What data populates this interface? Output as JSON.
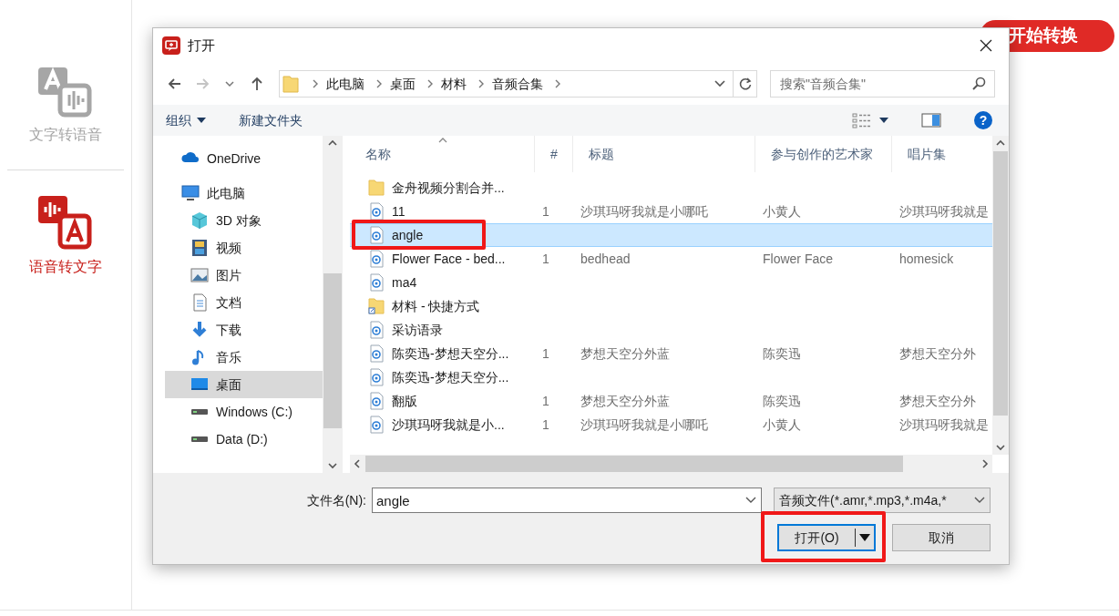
{
  "sidebar": {
    "items": [
      {
        "label": "文字转语音",
        "kind": "text-to-speech",
        "selected": false
      },
      {
        "label": "语音转文字",
        "kind": "speech-to-text",
        "selected": true
      }
    ]
  },
  "start_button": {
    "label": "开始转换"
  },
  "dialog": {
    "title": "打开",
    "breadcrumb": [
      "此电脑",
      "桌面",
      "材料",
      "音频合集"
    ],
    "search": {
      "placeholder": "搜索\"音频合集\""
    },
    "toolbar": {
      "organize": "组织",
      "new_folder": "新建文件夹",
      "help": "?"
    },
    "nav": [
      {
        "label": "OneDrive",
        "kind": "cloud",
        "selected": false
      },
      {
        "label": "此电脑",
        "kind": "pc",
        "selected": false,
        "children": [
          {
            "label": "3D 对象",
            "kind": "cube",
            "selected": false
          },
          {
            "label": "视频",
            "kind": "video",
            "selected": false
          },
          {
            "label": "图片",
            "kind": "picture",
            "selected": false
          },
          {
            "label": "文档",
            "kind": "document",
            "selected": false
          },
          {
            "label": "下载",
            "kind": "download",
            "selected": false
          },
          {
            "label": "音乐",
            "kind": "music",
            "selected": false
          },
          {
            "label": "桌面",
            "kind": "desktop",
            "selected": true
          },
          {
            "label": "Windows (C:)",
            "kind": "drive",
            "selected": false
          },
          {
            "label": "Data (D:)",
            "kind": "drive",
            "selected": false
          }
        ]
      }
    ],
    "columns": [
      {
        "label": "名称",
        "sorted": true
      },
      {
        "label": "#"
      },
      {
        "label": "标题"
      },
      {
        "label": "参与创作的艺术家"
      },
      {
        "label": "唱片集"
      }
    ],
    "files": [
      {
        "kind": "folder",
        "name": "金舟视频分割合并...",
        "selected": false,
        "highlighted": false
      },
      {
        "kind": "audio",
        "name": "11",
        "track": "1",
        "title": "沙琪玛呀我就是小哪吒",
        "artist": "小黄人",
        "album": "沙琪玛呀我就是",
        "selected": false,
        "highlighted": false
      },
      {
        "kind": "audio",
        "name": "angle",
        "selected": true,
        "highlighted": true
      },
      {
        "kind": "audio",
        "name": "Flower Face - bed...",
        "track": "1",
        "title": "bedhead",
        "artist": "Flower Face",
        "album": "homesick",
        "selected": false,
        "highlighted": false
      },
      {
        "kind": "audio",
        "name": "ma4",
        "selected": false,
        "highlighted": false
      },
      {
        "kind": "shortcut",
        "name": "材料 - 快捷方式",
        "selected": false,
        "highlighted": false
      },
      {
        "kind": "audio",
        "name": "采访语录",
        "selected": false,
        "highlighted": false
      },
      {
        "kind": "audio",
        "name": "陈奕迅-梦想天空分...",
        "track": "1",
        "title": "梦想天空分外蓝",
        "artist": "陈奕迅",
        "album": "梦想天空分外",
        "selected": false,
        "highlighted": false
      },
      {
        "kind": "audio",
        "name": "陈奕迅-梦想天空分...",
        "selected": false,
        "highlighted": false
      },
      {
        "kind": "audio",
        "name": "翻版",
        "track": "1",
        "title": "梦想天空分外蓝",
        "artist": "陈奕迅",
        "album": "梦想天空分外",
        "selected": false,
        "highlighted": false
      },
      {
        "kind": "audio",
        "name": "沙琪玛呀我就是小...",
        "track": "1",
        "title": "沙琪玛呀我就是小哪吒",
        "artist": "小黄人",
        "album": "沙琪玛呀我就是",
        "selected": false,
        "highlighted": false
      }
    ],
    "filename_label": "文件名(N):",
    "filename": "angle",
    "filter": "音频文件(*.amr,*.mp3,*.m4a,*",
    "buttons": [
      {
        "label": "打开(O)",
        "kind": "split",
        "highlighted": true
      },
      {
        "label": "取消",
        "kind": "plain",
        "highlighted": false
      }
    ]
  }
}
